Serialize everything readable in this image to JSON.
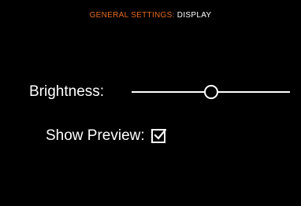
{
  "header": {
    "section": "GENERAL SETTINGS",
    "separator": ":",
    "page": "DISPLAY"
  },
  "brightness": {
    "label": "Brightness:",
    "value_fraction": 0.5
  },
  "preview": {
    "label": "Show Preview:",
    "checked": true
  },
  "colors": {
    "background": "#000000",
    "text": "#ffffff",
    "accent": "#e86a1f"
  },
  "icons": {
    "checkbox": "checkmark-icon",
    "slider_thumb": "slider-thumb"
  }
}
